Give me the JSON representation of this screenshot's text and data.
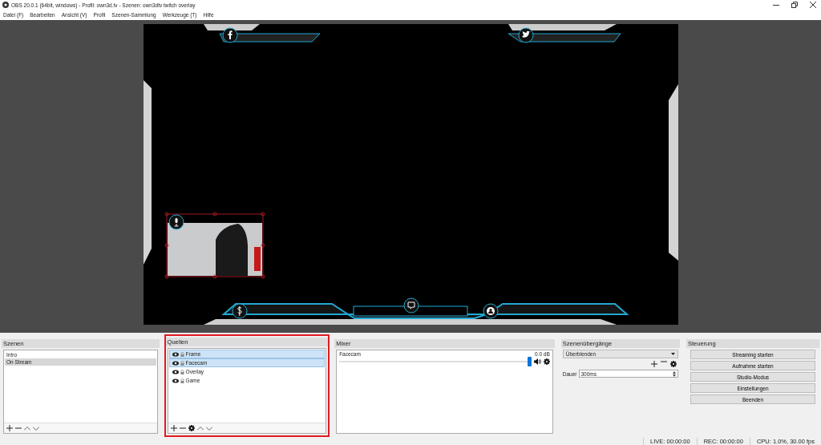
{
  "window": {
    "title": "OBS 20.0.1 (64bit, windows) - Profil: own3d.tv - Szenen: own3dtv twitch overlay"
  },
  "menu": [
    "Datei (F)",
    "Bearbeiten",
    "Ansicht (V)",
    "Profil",
    "Szenen-Sammlung",
    "Werkzeuge (T)",
    "Hilfe"
  ],
  "scenes": {
    "title": "Szenen",
    "items": [
      {
        "label": "Intro",
        "selected": false
      },
      {
        "label": "On Stream",
        "selected": true
      }
    ]
  },
  "sources": {
    "title": "Quellen",
    "highlighted": true,
    "items": [
      {
        "label": "Frame",
        "selected": true
      },
      {
        "label": "Facecam",
        "selected": true
      },
      {
        "label": "Overlay",
        "selected": false
      },
      {
        "label": "Game",
        "selected": false
      }
    ]
  },
  "mixer": {
    "title": "Mixer",
    "channels": [
      {
        "name": "Facecam",
        "reading": "0.0 dB",
        "level": 1
      }
    ]
  },
  "transitions": {
    "title": "Szenenübergänge",
    "value": "Überblenden",
    "duration_label": "Dauer",
    "duration": "300ms"
  },
  "controls": {
    "title": "Steuerung",
    "buttons": [
      "Streaming starten",
      "Aufnahme starten",
      "Studio-Modus",
      "Einstellungen",
      "Beenden"
    ]
  },
  "status_bar": [
    "LIVE: 00:00:00",
    "REC: 00:00:00",
    "CPU: 1.0%, 30.00 fps"
  ]
}
